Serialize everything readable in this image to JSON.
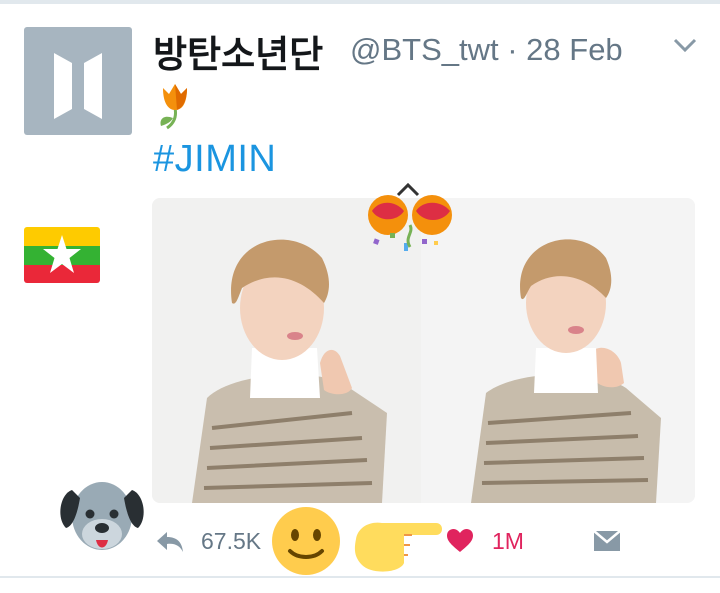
{
  "tweet": {
    "display_name": "방탄소년단",
    "handle_and_date": "@BTS_twt · 28 Feb",
    "hashtag": "#JIMIN",
    "emoji_line": "tulip-emoji",
    "media_count": 2
  },
  "actions": {
    "reply_count": "67.5K",
    "like_count": "1M"
  },
  "stickers": [
    "myanmar-flag",
    "confetti-popper",
    "dog-face",
    "smiley-face",
    "pointing-hand"
  ],
  "colors": {
    "link_blue": "#1b95e0",
    "like_red": "#e0245e",
    "muted_gray": "#657786",
    "avatar_gray": "#a7b5c0"
  }
}
